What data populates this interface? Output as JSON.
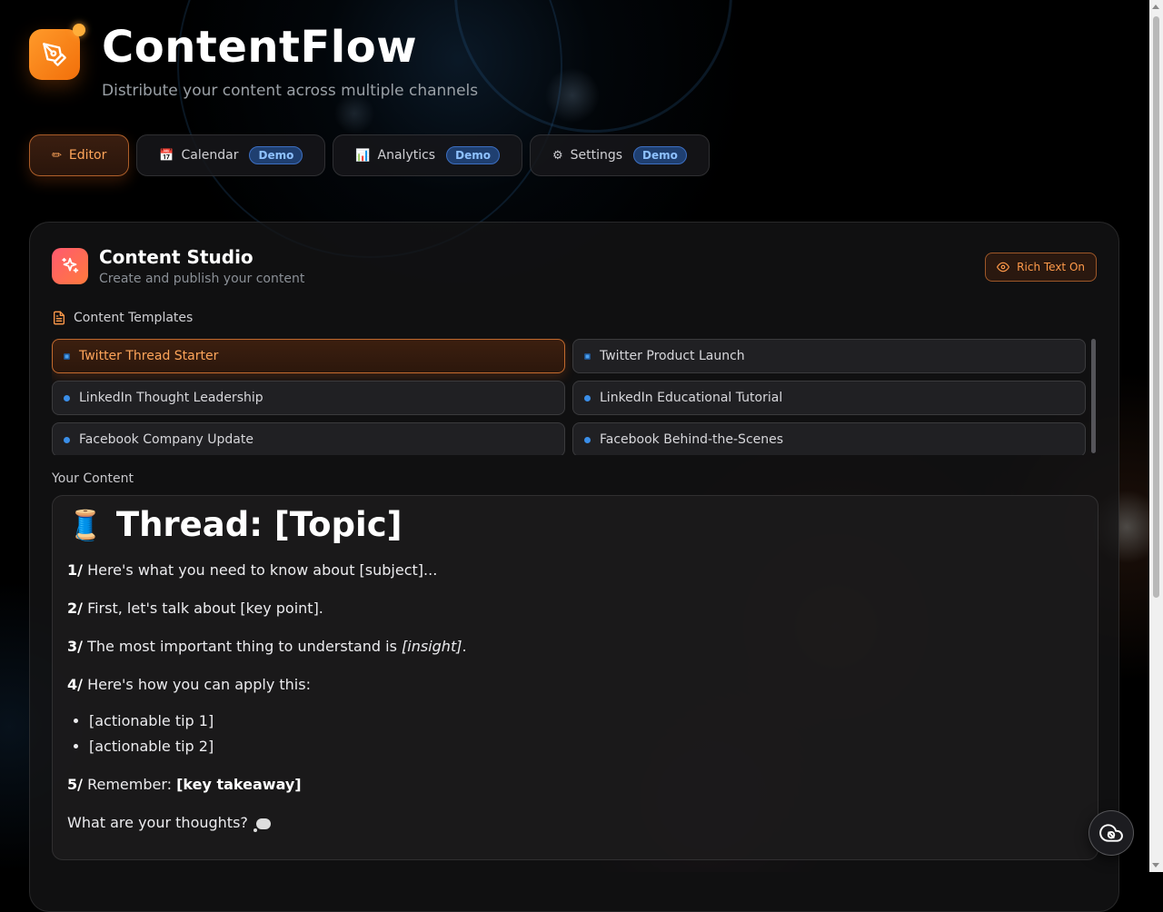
{
  "app": {
    "title": "ContentFlow",
    "subtitle": "Distribute your content across multiple channels",
    "logo_icon": "pen-tool-icon",
    "accent": "#f7851a"
  },
  "tabs": [
    {
      "label": "Editor",
      "icon": "✏",
      "active": true
    },
    {
      "label": "Calendar",
      "icon": "📅",
      "badge": "Demo"
    },
    {
      "label": "Analytics",
      "icon": "📊",
      "badge": "Demo"
    },
    {
      "label": "Settings",
      "icon": "⚙",
      "badge": "Demo"
    }
  ],
  "studio": {
    "title": "Content Studio",
    "subtitle": "Create and publish your content",
    "icon": "sparkles-icon",
    "rich_text_label": "Rich Text On"
  },
  "templates": {
    "heading": "Content Templates",
    "items": [
      {
        "label": "Twitter Thread Starter",
        "selected": true
      },
      {
        "label": "Twitter Product Launch"
      },
      {
        "label": "LinkedIn Thought Leadership"
      },
      {
        "label": "LinkedIn Educational Tutorial"
      },
      {
        "label": "Facebook Company Update"
      },
      {
        "label": "Facebook Behind-the-Scenes"
      }
    ]
  },
  "editor": {
    "label": "Your Content",
    "heading_emoji": "🧵",
    "heading": "Thread: [Topic]",
    "p1_num": "1/",
    "p1_text": " Here's what you need to know about [subject]...",
    "p2_num": "2/",
    "p2_text": " First, let's talk about [key point].",
    "p3_num": "3/",
    "p3_text_a": " The most important thing to understand is ",
    "p3_em": "[insight]",
    "p3_text_b": ".",
    "p4_num": "4/",
    "p4_text": " Here's how you can apply this:",
    "bullets": [
      "[actionable tip 1]",
      "[actionable tip 2]"
    ],
    "p5_num": "5/",
    "p5_text": " Remember: ",
    "p5_bold": "[key takeaway]",
    "closing": "What are your thoughts? "
  }
}
